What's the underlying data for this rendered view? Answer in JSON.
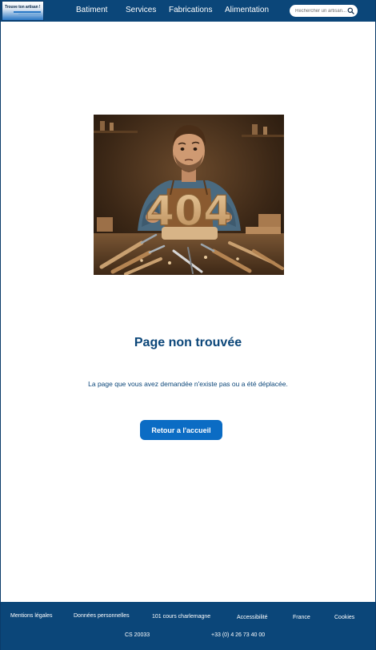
{
  "header": {
    "logo_text": "Trouve ton artisan !",
    "nav": [
      "Batiment",
      "Services",
      "Fabrications",
      "Alimentation"
    ],
    "search_placeholder": "Rechercher un artisan..."
  },
  "main": {
    "image_text": "404",
    "title": "Page non trouvée",
    "message": "La page que vous avez demandée n'existe pas ou a été déplacée.",
    "button_label": "Retour a l'accueil"
  },
  "footer": {
    "links": [
      "Mentions légales",
      "Données personnelles",
      "Accessibilité",
      "France",
      "Cookies"
    ],
    "address": "101 cours charlemagne",
    "postal": "CS 20033",
    "phone": "+33 (0) 4 26 73 40 00"
  },
  "colors": {
    "brand_blue": "#0b4679",
    "button_blue": "#0b6cc4"
  }
}
